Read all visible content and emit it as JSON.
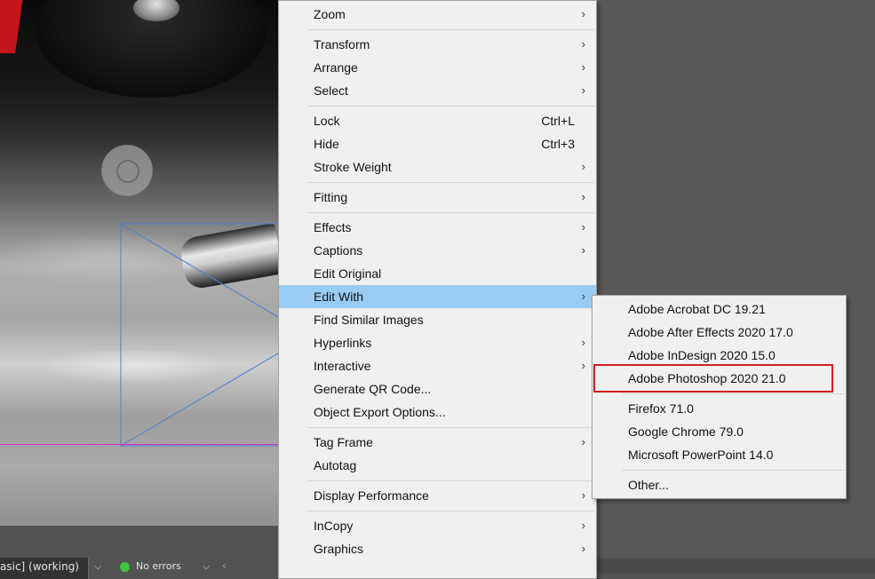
{
  "menu": {
    "groups": [
      [
        {
          "label": "Zoom",
          "submenu": true
        }
      ],
      [
        {
          "label": "Transform",
          "submenu": true
        },
        {
          "label": "Arrange",
          "submenu": true
        },
        {
          "label": "Select",
          "submenu": true
        }
      ],
      [
        {
          "label": "Lock",
          "shortcut": "Ctrl+L"
        },
        {
          "label": "Hide",
          "shortcut": "Ctrl+3"
        },
        {
          "label": "Stroke Weight",
          "submenu": true
        }
      ],
      [
        {
          "label": "Fitting",
          "submenu": true
        }
      ],
      [
        {
          "label": "Effects",
          "submenu": true
        },
        {
          "label": "Captions",
          "submenu": true
        },
        {
          "label": "Edit Original"
        },
        {
          "label": "Edit With",
          "submenu": true,
          "active": true
        },
        {
          "label": "Find Similar Images"
        },
        {
          "label": "Hyperlinks",
          "submenu": true
        },
        {
          "label": "Interactive",
          "submenu": true
        },
        {
          "label": "Generate QR Code..."
        },
        {
          "label": "Object Export Options..."
        }
      ],
      [
        {
          "label": "Tag Frame",
          "submenu": true
        },
        {
          "label": "Autotag"
        }
      ],
      [
        {
          "label": "Display Performance",
          "submenu": true
        }
      ],
      [
        {
          "label": "InCopy",
          "submenu": true
        },
        {
          "label": "Graphics",
          "submenu": true
        }
      ]
    ]
  },
  "submenu": {
    "groups": [
      [
        {
          "label": "Adobe Acrobat DC 19.21"
        },
        {
          "label": "Adobe After Effects 2020 17.0"
        },
        {
          "label": "Adobe InDesign 2020 15.0"
        },
        {
          "label": "Adobe Photoshop 2020 21.0",
          "highlighted": true
        }
      ],
      [
        {
          "label": "Firefox 71.0"
        },
        {
          "label": "Google Chrome 79.0"
        },
        {
          "label": "Microsoft PowerPoint 14.0"
        }
      ],
      [
        {
          "label": "Other..."
        }
      ]
    ]
  },
  "status_bar": {
    "profile_text": "asic] (working)",
    "preflight_text": "No errors"
  },
  "icons": {
    "submenu_arrow": "chevron-right-icon",
    "dropdown": "chevron-down-icon",
    "preflight_status": "green-dot-icon"
  },
  "colors": {
    "menu_background": "#f0f0f0",
    "menu_active": "#99ccf3",
    "highlight_box": "#d21e1e",
    "preflight_ok": "#3ec43e",
    "frame_edge": "#d62cc8"
  }
}
